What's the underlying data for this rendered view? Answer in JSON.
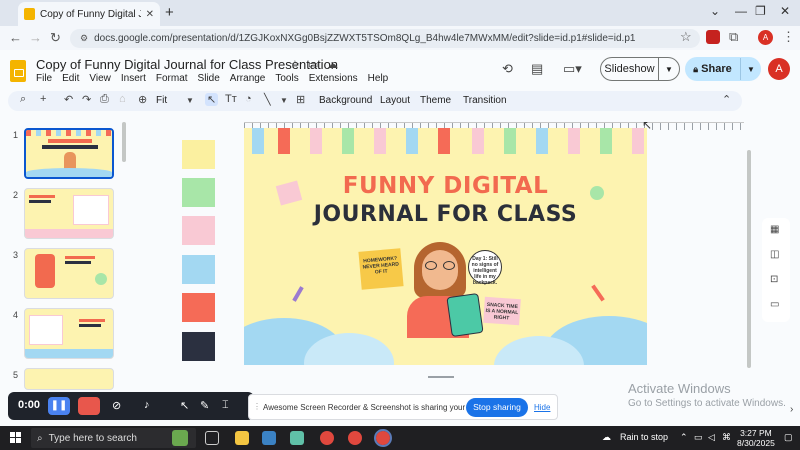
{
  "browser": {
    "tab_title": "Copy of Funny Digital Journal for Class P",
    "tab_close": "✕",
    "new_tab": "+",
    "url": "docs.google.com/presentation/d/1ZGJKoxNXGg0BsjZZWXT5TSOm8QLg_B4hw4le7MWxMM/edit?slide=id.p1#slide=id.p1",
    "window_controls": [
      "⌄",
      "—",
      "❐",
      "✕"
    ]
  },
  "doc": {
    "title": "Copy of Funny Digital Journal for Class Presentation",
    "menu": [
      "File",
      "Edit",
      "View",
      "Insert",
      "Format",
      "Slide",
      "Arrange",
      "Tools",
      "Extensions",
      "Help"
    ],
    "slideshow_label": "Slideshow",
    "share_label": "Share",
    "avatar_letter": "A"
  },
  "toolbar": {
    "zoom": "Fit",
    "background": "Background",
    "layout": "Layout",
    "theme": "Theme",
    "transition": "Transition"
  },
  "filmstrip": {
    "numbers": [
      "1",
      "2",
      "3",
      "4",
      "5"
    ]
  },
  "slide": {
    "title_line1": "FUNNY DIGITAL",
    "title_line2": "JOURNAL FOR CLASS",
    "note_left": "HOMEWORK? NEVER HEARD OF IT",
    "bubble": "Day 1: Still no signs of intelligent life in my backpack.",
    "note_right": "SNACK TIME IS A NORMAL RIGHT"
  },
  "swatch_colors": [
    "#fbf0a0",
    "#a8e6a8",
    "#f9c9d4",
    "#a3d8f2",
    "#f56b57",
    "#2b3040"
  ],
  "recorder": {
    "time": "0:00"
  },
  "sharing_bar": {
    "message": "Awesome Screen Recorder & Screenshot is sharing your screen.",
    "stop_label": "Stop sharing",
    "hide_label": "Hide"
  },
  "watermark": {
    "line1": "Activate Windows",
    "line2": "Go to Settings to activate Windows."
  },
  "taskbar": {
    "search_placeholder": "Type here to search",
    "weather": "Rain to stop",
    "time": "3:27 PM",
    "date": "8/30/2025"
  }
}
